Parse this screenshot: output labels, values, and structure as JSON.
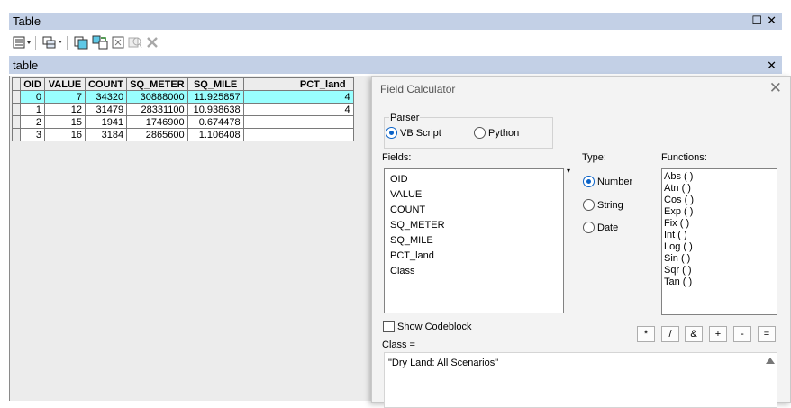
{
  "window": {
    "title": "Table",
    "restore_glyph": "☐",
    "close_glyph": "✕"
  },
  "toolbar": {
    "buttons": [
      {
        "name": "table-options-icon"
      },
      {
        "name": "related-tables-icon"
      },
      {
        "name": "select-by-attributes-icon"
      },
      {
        "name": "switch-selection-icon"
      },
      {
        "name": "clear-selection-icon"
      },
      {
        "name": "zoom-to-selected-icon"
      },
      {
        "name": "delete-selected-icon"
      }
    ]
  },
  "tab": {
    "title": "table",
    "close_glyph": "✕"
  },
  "table": {
    "columns": [
      "OID",
      "VALUE",
      "COUNT",
      "SQ_METER",
      "SQ_MILE",
      "PCT_land"
    ],
    "rows": [
      [
        "0",
        "7",
        "34320",
        "30888000",
        "11.925857",
        "4"
      ],
      [
        "1",
        "12",
        "31479",
        "28331100",
        "10.938638",
        "4"
      ],
      [
        "2",
        "15",
        "1941",
        "1746900",
        "0.674478",
        ""
      ],
      [
        "3",
        "16",
        "3184",
        "2865600",
        "1.106408",
        ""
      ]
    ]
  },
  "dialog": {
    "title": "Field Calculator",
    "close_glyph": "✕",
    "parser_label": "Parser",
    "parser_options": [
      "VB Script",
      "Python"
    ],
    "parser_selected": "VB Script",
    "fields_label": "Fields:",
    "fields": [
      "OID",
      "VALUE",
      "COUNT",
      "SQ_METER",
      "SQ_MILE",
      "PCT_land",
      "Class"
    ],
    "type_label": "Type:",
    "types": [
      "Number",
      "String",
      "Date"
    ],
    "type_selected": "Number",
    "functions_label": "Functions:",
    "functions": [
      "Abs ( )",
      "Atn ( )",
      "Cos ( )",
      "Exp ( )",
      "Fix ( )",
      "Int ( )",
      "Log ( )",
      "Sin ( )",
      "Sqr ( )",
      "Tan ( )"
    ],
    "show_codeblock_label": "Show Codeblock",
    "operators": [
      "*",
      "/",
      "&",
      "+",
      "-",
      "="
    ],
    "expression_label": "Class =",
    "expression": "\"Dry Land: All Scenarios\""
  },
  "colors": {
    "title_bar": "#c3d0e6",
    "selected_row": "#99ffff",
    "radio_accent": "#0a62c7"
  }
}
